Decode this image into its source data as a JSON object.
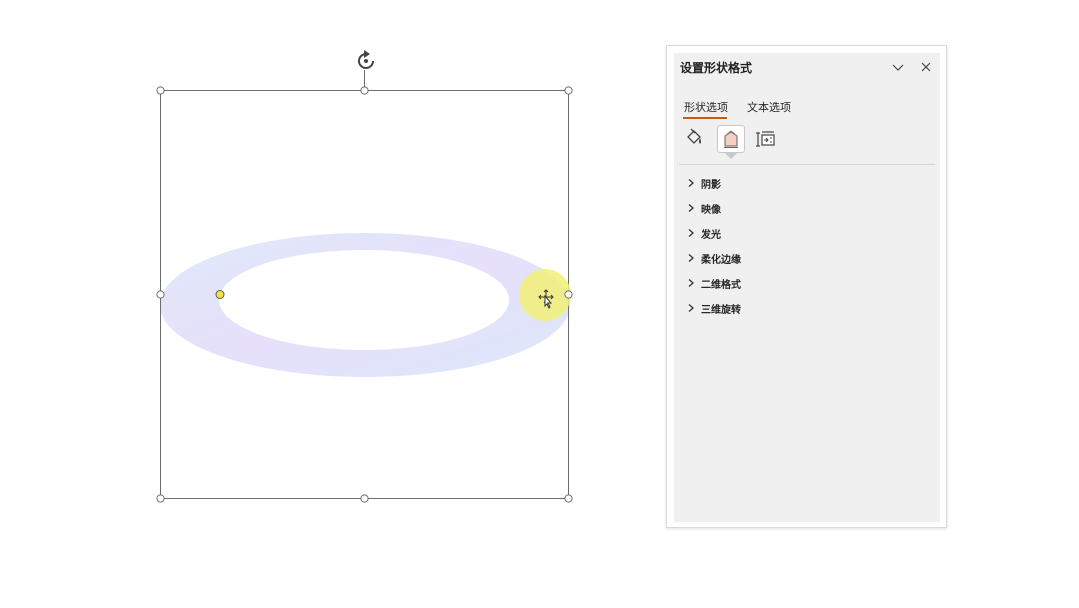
{
  "pane": {
    "title": "设置形状格式",
    "tabs": [
      {
        "label": "形状选项",
        "selected": true
      },
      {
        "label": "文本选项",
        "selected": false
      }
    ],
    "categories": [
      {
        "icon": "fill-line-icon",
        "selected": false
      },
      {
        "icon": "effects-icon",
        "selected": true
      },
      {
        "icon": "size-properties-icon",
        "selected": false
      }
    ],
    "sections": [
      {
        "label": "阴影"
      },
      {
        "label": "映像"
      },
      {
        "label": "发光"
      },
      {
        "label": "柔化边缘"
      },
      {
        "label": "二维格式"
      },
      {
        "label": "三维旋转"
      }
    ]
  },
  "colors": {
    "accent": "#c55a11",
    "ring_gradient": [
      "#dfe9fb",
      "#e6e0fa",
      "#dce8fb"
    ],
    "cursor_highlight": "#f2f077",
    "adjust_handle": "#f5e04a"
  }
}
